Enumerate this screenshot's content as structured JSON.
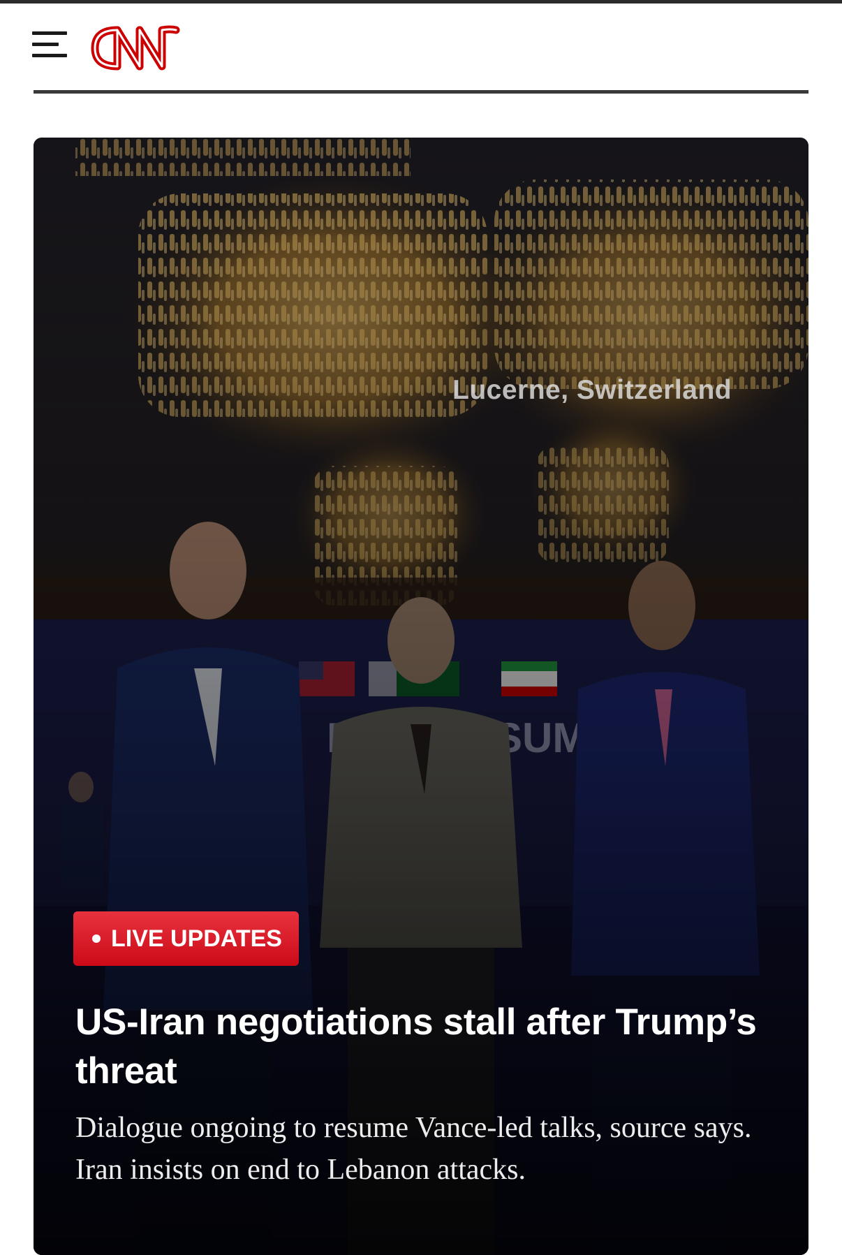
{
  "header": {
    "menu_icon": "hamburger-menu-icon",
    "logo_text": "CNN",
    "logo_color": "#cc0000"
  },
  "hero": {
    "image_description_icon": "news-photo",
    "location_caption": "Lucerne, Switzerland",
    "badge": {
      "label": "LIVE UPDATES",
      "color": "#cc0a18"
    },
    "headline": "US-Iran negotiations stall after Trump’s threat",
    "summary": "Dialogue ongoing to resume Vance-led talks, source says. Iran insists on end to Lebanon attacks."
  }
}
